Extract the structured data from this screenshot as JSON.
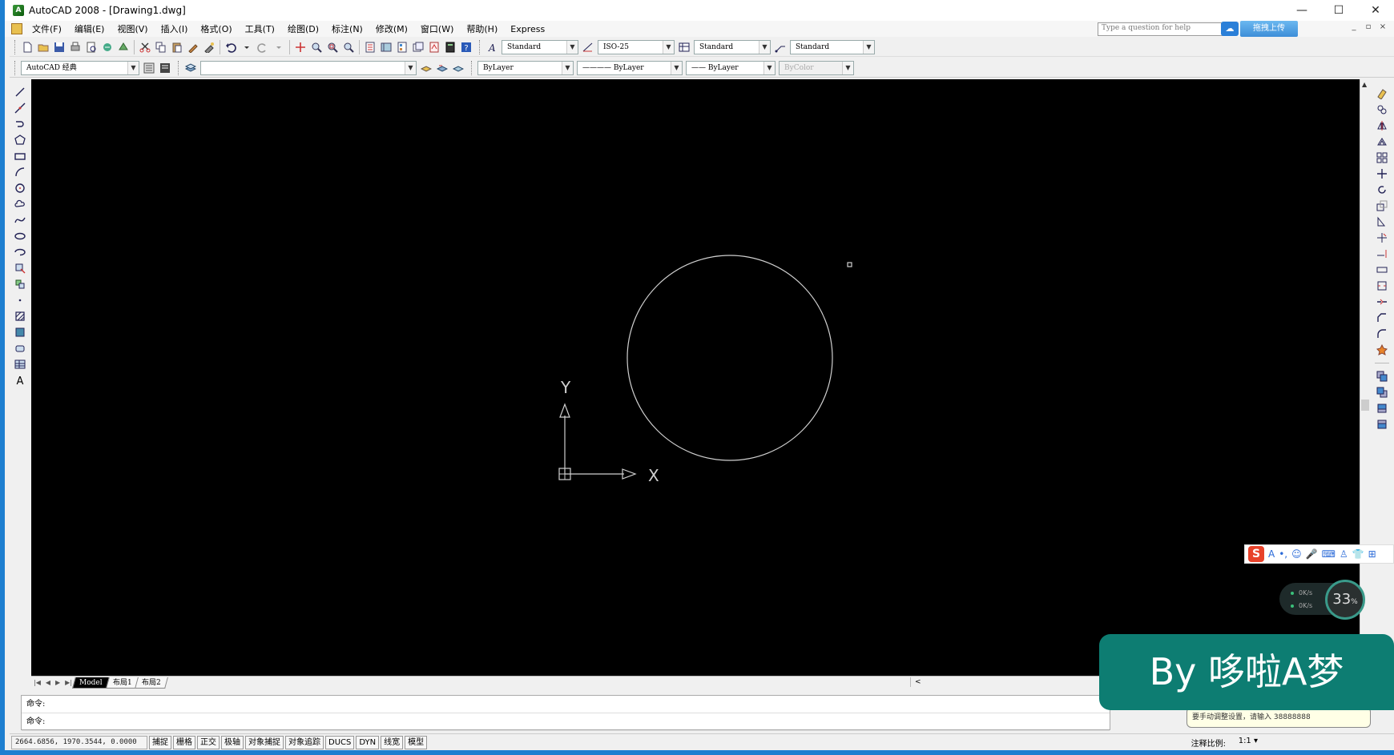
{
  "window": {
    "title": "AutoCAD 2008 - [Drawing1.dwg]",
    "app_icon_text": "A",
    "minimize": "—",
    "maximize": "☐",
    "close": "✕"
  },
  "menubar": {
    "items": [
      "文件(F)",
      "编辑(E)",
      "视图(V)",
      "插入(I)",
      "格式(O)",
      "工具(T)",
      "绘图(D)",
      "标注(N)",
      "修改(M)",
      "窗口(W)",
      "帮助(H)",
      "Express"
    ],
    "help_placeholder": "Type a question for help",
    "upload_label": "拖拽上传",
    "doc_buttons": [
      "_",
      "▫",
      "×"
    ]
  },
  "styles_toolbar": {
    "text_style": "Standard",
    "dim_style": "ISO-25",
    "table_style": "Standard",
    "multileader_style": "Standard"
  },
  "workspace_toolbar": {
    "workspace": "AutoCAD 经典",
    "layer": "",
    "color": "ByLayer",
    "linetype": "———— ByLayer",
    "lineweight": "—— ByLayer",
    "plotstyle": "ByColor"
  },
  "canvas": {
    "ucs_x_label": "X",
    "ucs_y_label": "Y"
  },
  "layout_tabs": {
    "tabs": [
      "Model",
      "布局1",
      "布局2"
    ],
    "active": "Model"
  },
  "command": {
    "line1": "命令:",
    "line2": "命令:"
  },
  "status": {
    "coords": "2664.6856, 1970.3544, 0.0000",
    "buttons": [
      "捕捉",
      "栅格",
      "正交",
      "极轴",
      "对象捕捉",
      "对象追踪",
      "DUCS",
      "DYN",
      "线宽",
      "模型"
    ],
    "annotation_scale_label": "注释比例:",
    "annotation_scale_value": "1:1 ▾"
  },
  "tooltip": {
    "text": "要手动调整设置，请输入 38888888"
  },
  "overlay": {
    "watermark": "By 哆啦A梦",
    "net_up": "0K/s",
    "net_down": "0K/s",
    "net_percent": "33",
    "net_percent_unit": "%",
    "ime_logo": "S",
    "ime_icons": [
      "A",
      "•,",
      "☺",
      "🎤",
      "⌨",
      "♙",
      "👕",
      "⊞"
    ]
  },
  "colors": {
    "canvas_bg": "#000000",
    "geometry": "#d0d0d0",
    "watermark_bg": "#0d7d72",
    "window_border": "#1e7fd0"
  }
}
